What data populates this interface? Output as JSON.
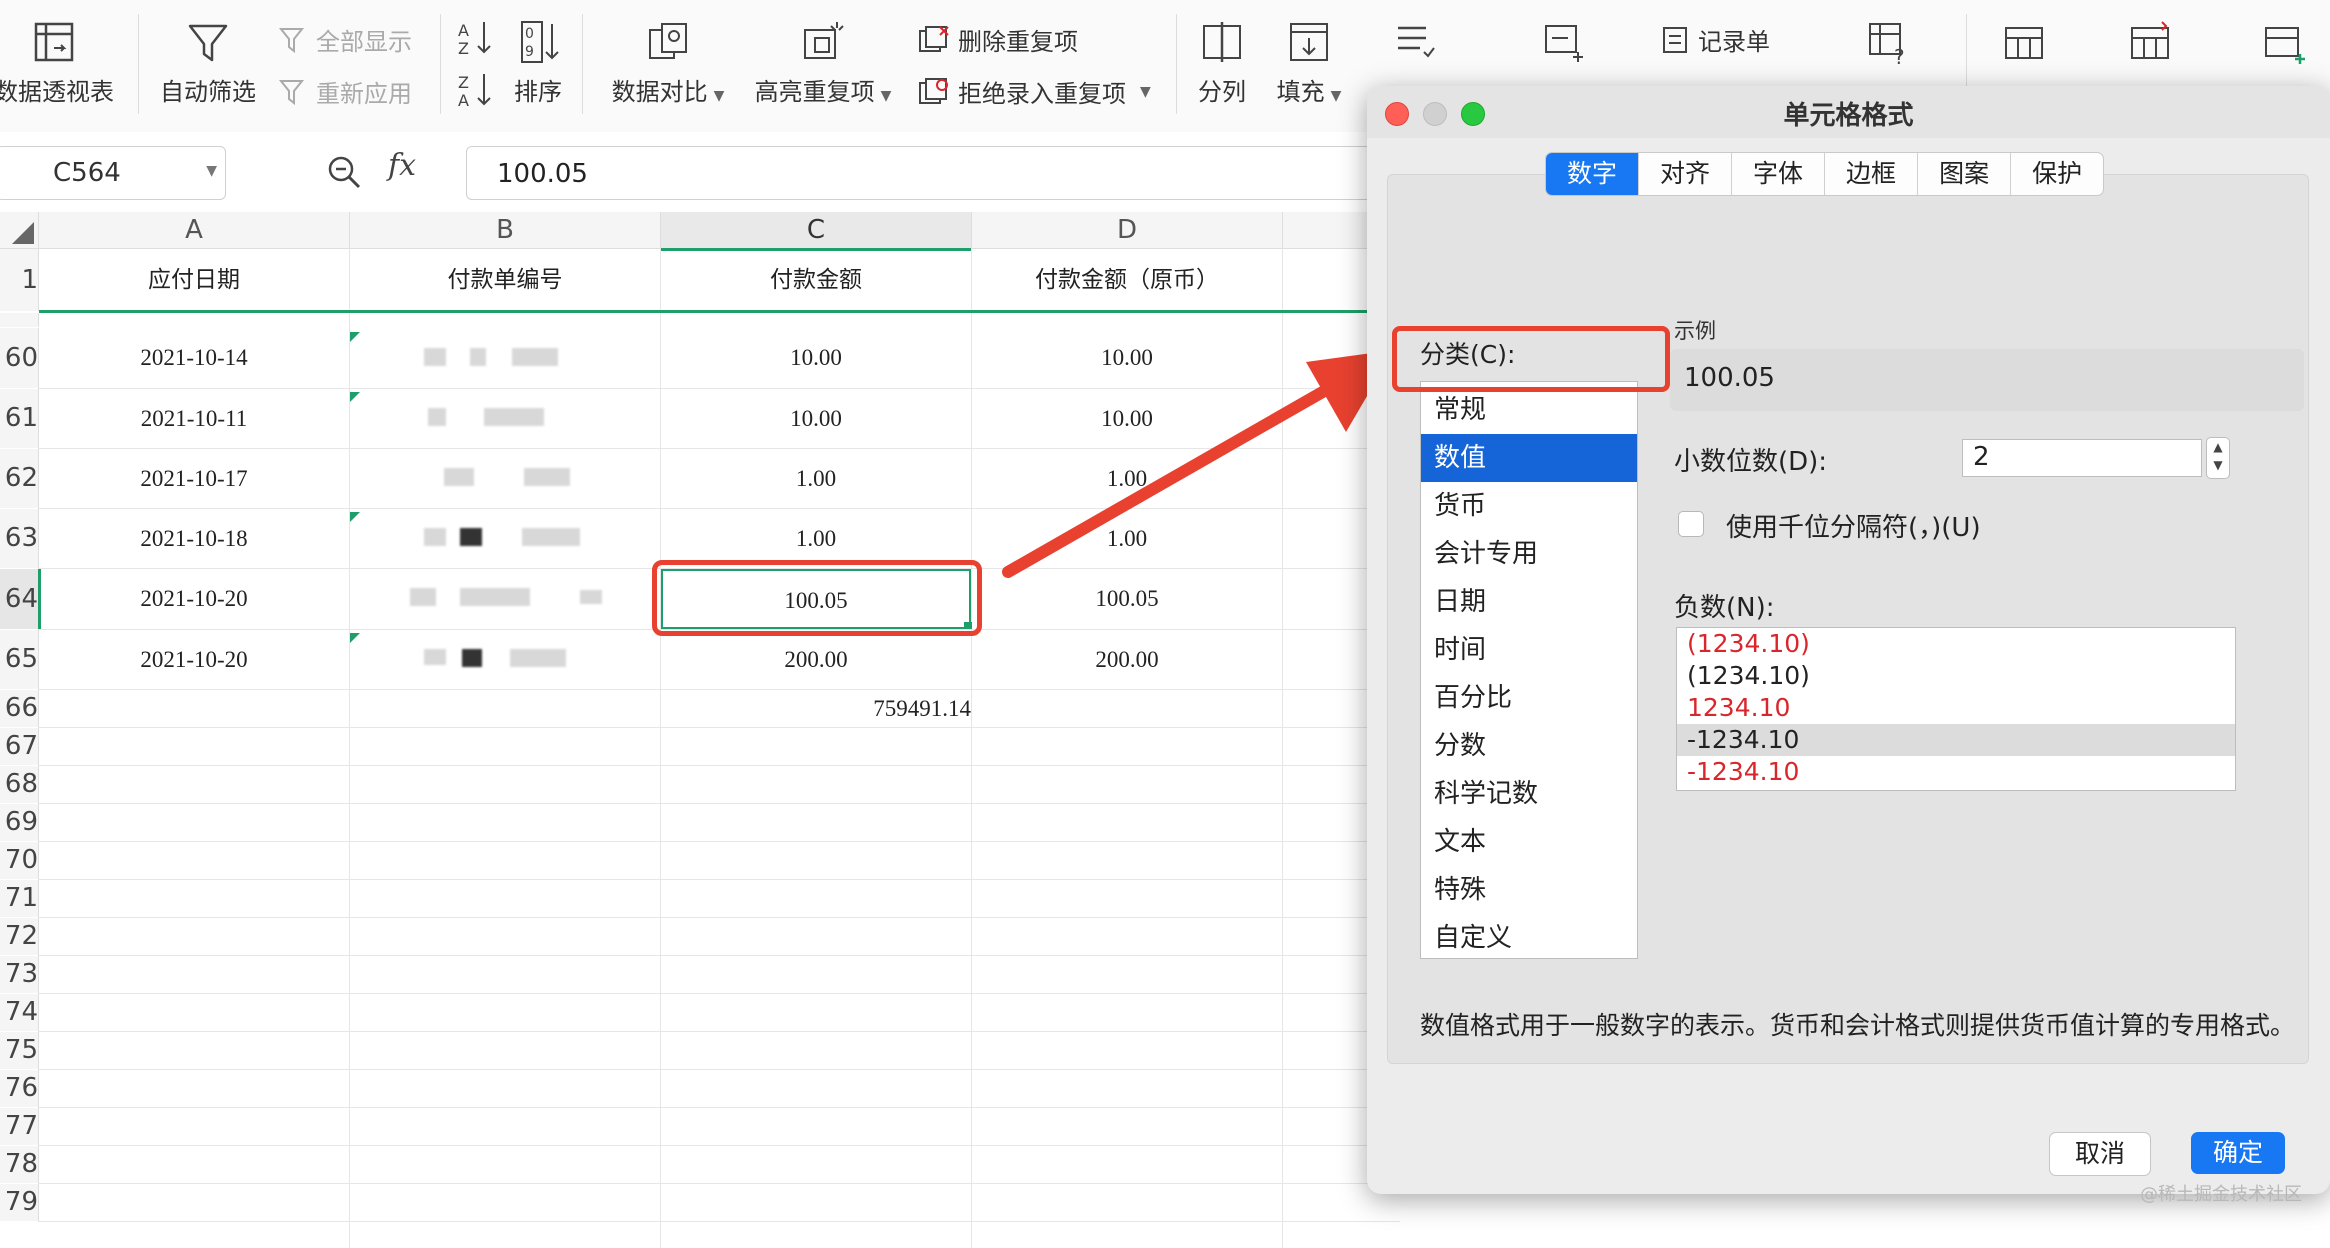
{
  "toolbar": {
    "pivot_label": "数据透视表",
    "autofilter_label": "自动筛选",
    "show_all_label": "全部显示",
    "reapply_label": "重新应用",
    "sort_label": "排序",
    "compare_label": "数据对比",
    "highlight_dup_label": "高亮重复项",
    "remove_dup_label": "删除重复项",
    "reject_dup_label": "拒绝录入重复项",
    "split_label": "分列",
    "fill_label": "填充",
    "record_label": "记录单"
  },
  "formula_bar": {
    "cell_ref": "C564",
    "fx": "fx",
    "value": "100.05"
  },
  "grid": {
    "columns": [
      "A",
      "B",
      "C",
      "D"
    ],
    "header_row_num": "1",
    "headers": [
      "应付日期",
      "付款单编号",
      "付款金额",
      "付款金额（原币）"
    ],
    "rows": [
      {
        "num": "60",
        "date": "2021-10-14",
        "amount": "10.00",
        "amount_orig": "10.00"
      },
      {
        "num": "61",
        "date": "2021-10-11",
        "amount": "10.00",
        "amount_orig": "10.00"
      },
      {
        "num": "62",
        "date": "2021-10-17",
        "amount": "1.00",
        "amount_orig": "1.00"
      },
      {
        "num": "63",
        "date": "2021-10-18",
        "amount": "1.00",
        "amount_orig": "1.00"
      },
      {
        "num": "64",
        "date": "2021-10-20",
        "amount": "100.05",
        "amount_orig": "100.05"
      },
      {
        "num": "65",
        "date": "2021-10-20",
        "amount": "200.00",
        "amount_orig": "200.00"
      }
    ],
    "total_row_num": "66",
    "total_value": "759491.14",
    "empty_rows": [
      "67",
      "68",
      "69",
      "70",
      "71",
      "72",
      "73",
      "74",
      "75",
      "76",
      "77",
      "78",
      "79"
    ]
  },
  "dialog": {
    "title": "单元格格式",
    "tabs": [
      "数字",
      "对齐",
      "字体",
      "边框",
      "图案",
      "保护"
    ],
    "active_tab": "数字",
    "category_label": "分类(C):",
    "categories": [
      "常规",
      "数值",
      "货币",
      "会计专用",
      "日期",
      "时间",
      "百分比",
      "分数",
      "科学记数",
      "文本",
      "特殊",
      "自定义"
    ],
    "selected_category": "数值",
    "sample_label": "示例",
    "sample_value": "100.05",
    "decimals_label": "小数位数(D):",
    "decimals_value": "2",
    "thousands_label": "使用千位分隔符(，)(U)",
    "negative_label": "负数(N):",
    "negative_options": [
      {
        "text": "(1234.10)",
        "color": "#d9262c"
      },
      {
        "text": "(1234.10)",
        "color": "#222222"
      },
      {
        "text": "1234.10",
        "color": "#d9262c"
      },
      {
        "text": "-1234.10",
        "color": "#222222"
      },
      {
        "text": "-1234.10",
        "color": "#d9262c"
      }
    ],
    "description": "数值格式用于一般数字的表示。货币和会计格式则提供货币值计算的专用格式。",
    "cancel_label": "取消",
    "ok_label": "确定"
  },
  "annotation_color": "#e8412f",
  "accent_color": "#1877f2",
  "selection_color": "#1e9e6a",
  "watermark": "@稀土掘金技术社区"
}
